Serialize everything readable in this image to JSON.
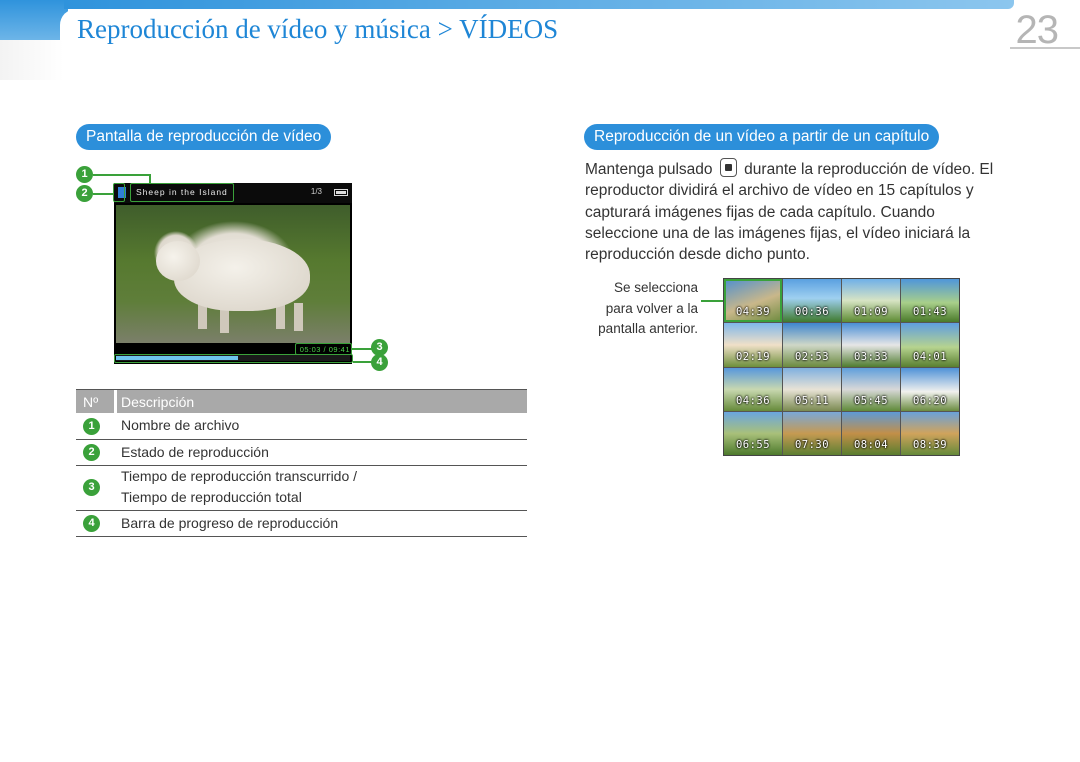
{
  "header": {
    "title": "Reproducción de vídeo y música > VÍDEOS",
    "page_number": "23"
  },
  "left_section": {
    "pill": "Pantalla de reproducción de vídeo",
    "screen": {
      "file_name": "Sheep in the Island",
      "file_count": "1/3",
      "time": "05:03 / 09:41",
      "progress": 0.52
    },
    "callouts": [
      "1",
      "2",
      "3",
      "4"
    ]
  },
  "table": {
    "headers": {
      "num": "Nº",
      "desc": "Descripción"
    },
    "rows": [
      {
        "num": "1",
        "desc": "Nombre de archivo"
      },
      {
        "num": "2",
        "desc": "Estado de reproducción"
      },
      {
        "num": "3",
        "desc_line1": "Tiempo de reproducción transcurrido /",
        "desc_line2": "Tiempo de reproducción total"
      },
      {
        "num": "4",
        "desc": "Barra de progreso de reproducción"
      }
    ]
  },
  "right_section": {
    "pill": "Reproducción de un vídeo a partir de un capítulo",
    "para_before_icon": "Mantenga pulsado",
    "para_after_icon": "durante la reproducción de vídeo. El reproductor dividirá el archivo de vídeo en 15 capítulos y capturará imágenes fijas de cada capítulo. Cuando seleccione una de las imágenes fijas, el vídeo iniciará la reproducción desde dicho punto.",
    "note_lines": [
      "Se selecciona",
      "para volver a la",
      "pantalla anterior."
    ],
    "chapters": [
      "",
      "00:36",
      "01:09",
      "01:43",
      "02:19",
      "02:53",
      "03:33",
      "04:01",
      "04:36",
      "05:11",
      "05:45",
      "06:20",
      "06:55",
      "07:30",
      "08:04",
      "08:39"
    ],
    "first_cell_time": "04:39"
  },
  "colors": {
    "accent_blue": "#2c8fda",
    "callout_green": "#3aa13a",
    "table_header_gray": "#a9a9a9"
  }
}
